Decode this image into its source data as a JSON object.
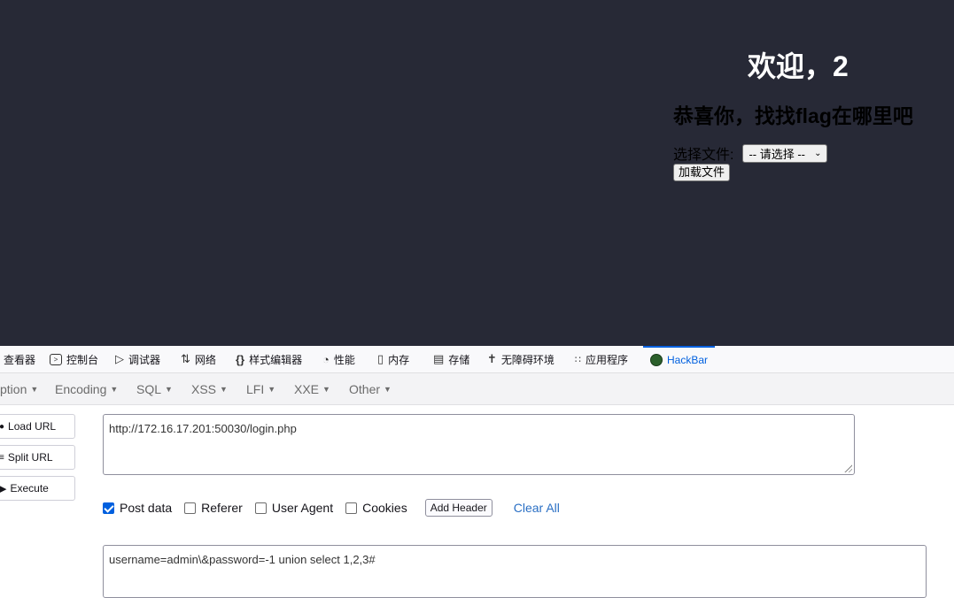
{
  "page": {
    "welcome": "欢迎，2",
    "subtitle": "恭喜你，找找flag在哪里吧",
    "file_label": "选择文件:",
    "select_value": "-- 请选择 --",
    "load_button": "加载文件"
  },
  "devtools": {
    "tabs": [
      {
        "label": "查看器",
        "icon": "inspector-icon"
      },
      {
        "label": "控制台",
        "icon": "console-icon"
      },
      {
        "label": "调试器",
        "icon": "debugger-icon"
      },
      {
        "label": "网络",
        "icon": "network-icon"
      },
      {
        "label": "样式编辑器",
        "icon": "style-editor-icon"
      },
      {
        "label": "性能",
        "icon": "performance-icon"
      },
      {
        "label": "内存",
        "icon": "memory-icon"
      },
      {
        "label": "存储",
        "icon": "storage-icon"
      },
      {
        "label": "无障碍环境",
        "icon": "accessibility-icon"
      },
      {
        "label": "应用程序",
        "icon": "application-icon"
      },
      {
        "label": "HackBar",
        "icon": "hackbar-logo-icon"
      }
    ],
    "active_tab": "HackBar",
    "accent_color": "#0060df"
  },
  "hackbar": {
    "menus": [
      "ption",
      "Encoding",
      "SQL",
      "XSS",
      "LFI",
      "XXE",
      "Other"
    ],
    "buttons": {
      "load_url": "Load URL",
      "split_url": "Split URL",
      "execute": "Execute"
    },
    "url": "http://172.16.17.201:50030/login.php",
    "options": {
      "post_data": {
        "label": "Post data",
        "checked": true
      },
      "referer": {
        "label": "Referer",
        "checked": false
      },
      "user_agent": {
        "label": "User Agent",
        "checked": false
      },
      "cookies": {
        "label": "Cookies",
        "checked": false
      }
    },
    "add_header": "Add Header",
    "clear_all": "Clear All",
    "post_body": "username=admin\\&password=-1 union select 1,2,3#"
  }
}
